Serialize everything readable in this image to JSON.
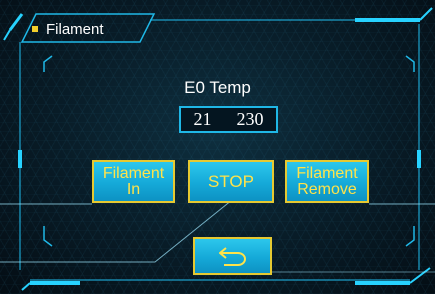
{
  "header": {
    "title": "Filament"
  },
  "temperature": {
    "label": "E0 Temp",
    "current": "21",
    "target": "230"
  },
  "buttons": {
    "filament_in_line1": "Filament",
    "filament_in_line2": "In",
    "stop": "STOP",
    "filament_remove_line1": "Filament",
    "filament_remove_line2": "Remove",
    "back_icon": "return-arrow-icon"
  },
  "colors": {
    "accent_cyan": "#1fb7e6",
    "button_fill": "#15a9d8",
    "button_text": "#ffe34a",
    "button_border": "#e6c931",
    "title_bullet": "#f2cf2c",
    "background": "#081b26"
  }
}
